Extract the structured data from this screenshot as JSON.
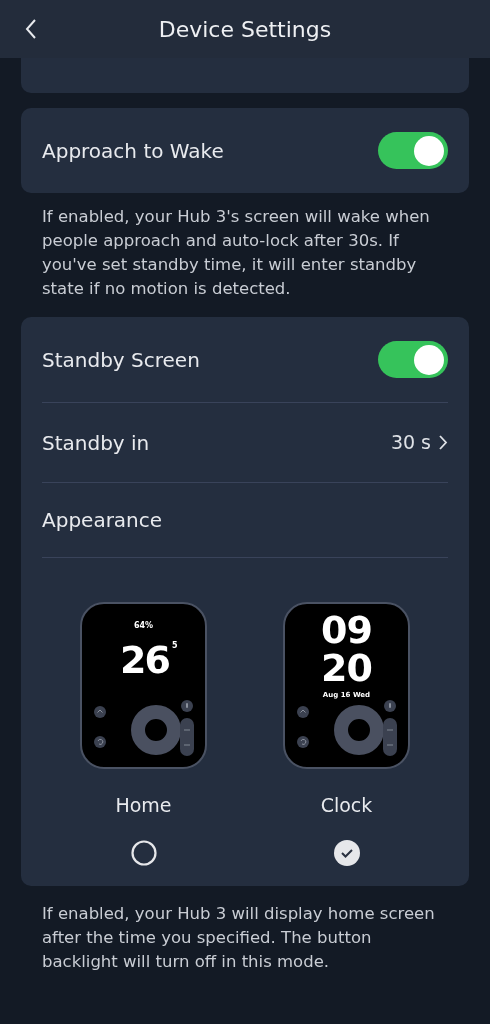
{
  "header": {
    "title": "Device Settings"
  },
  "approach": {
    "label": "Approach to Wake",
    "on": true,
    "description": "If enabled, your Hub 3's screen will wake when people approach and auto-lock after 30s. If you've set standby time, it will enter standby state if no motion is detected."
  },
  "standby": {
    "toggle": {
      "label": "Standby Screen",
      "on": true
    },
    "standby_in": {
      "label": "Standby in",
      "value": "30 s"
    },
    "appearance": {
      "label": "Appearance",
      "options": [
        {
          "kind": "home",
          "label": "Home",
          "selected": false,
          "screen": {
            "battery": "64%",
            "temperature": "26",
            "superscript": "5"
          }
        },
        {
          "kind": "clock",
          "label": "Clock",
          "selected": true,
          "screen": {
            "hour": "09",
            "minute": "20",
            "date": "Aug 16 Wed"
          }
        }
      ]
    }
  },
  "footer_note": "If enabled, your Hub 3 will display home screen after the time you specified. The button backlight will turn off in this mode."
}
